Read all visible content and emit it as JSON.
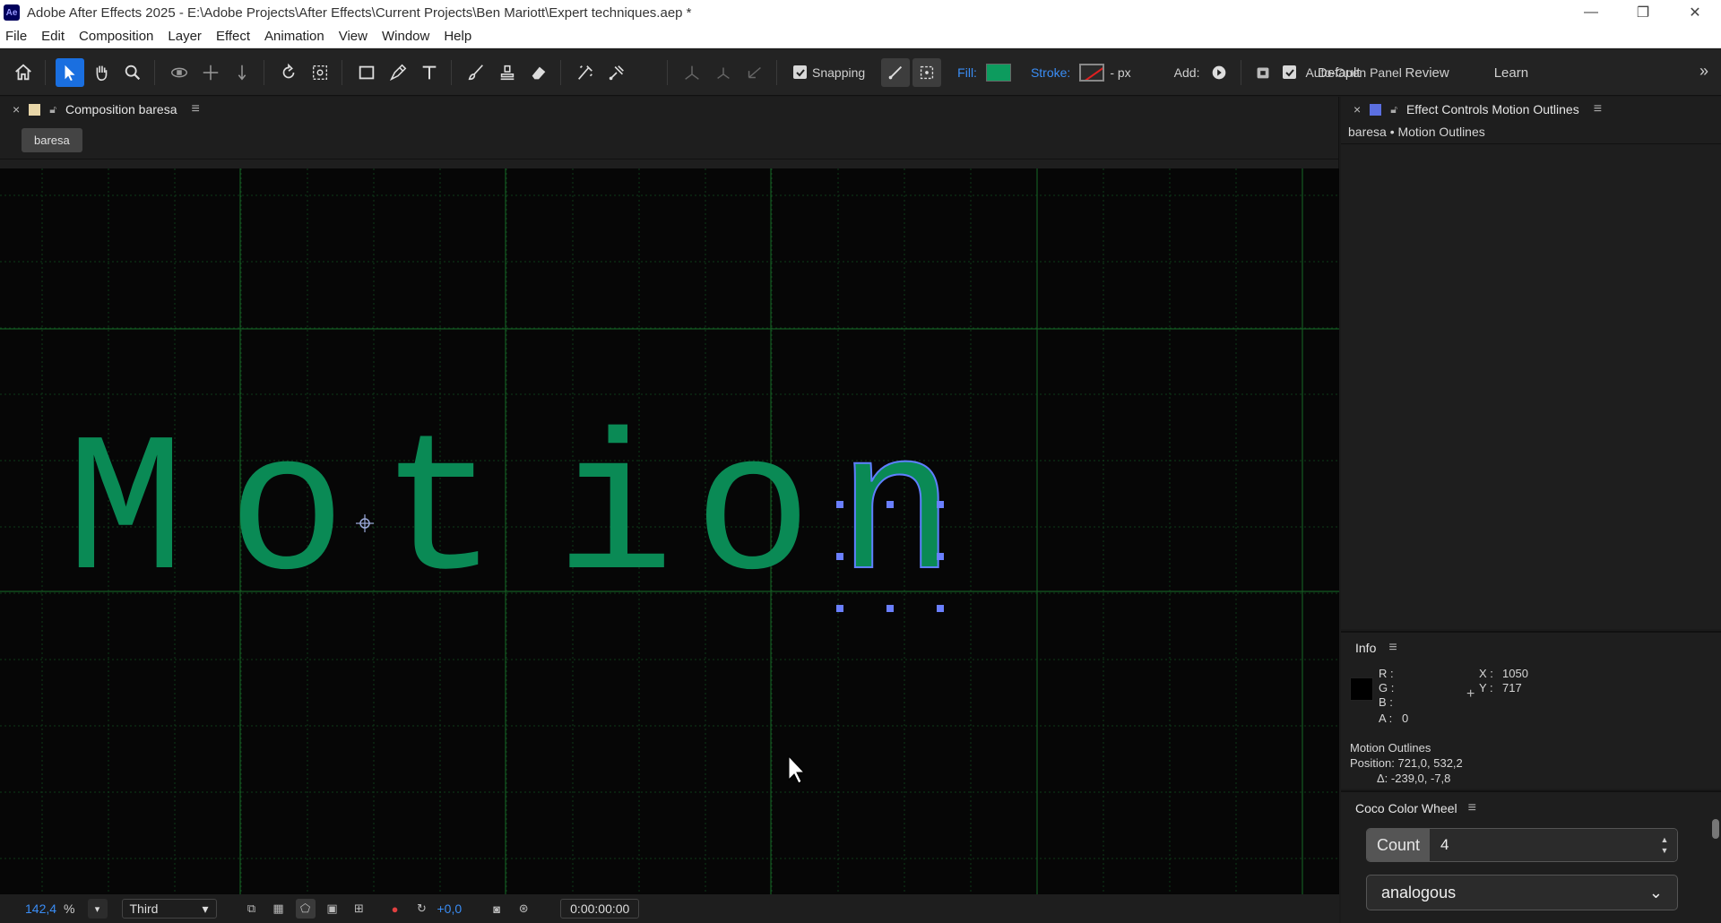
{
  "window": {
    "app_icon_text": "Ae",
    "title": "Adobe After Effects 2025 - E:\\Adobe Projects\\After Effects\\Current Projects\\Ben Mariott\\Expert techniques.aep *",
    "minimize": "—",
    "restore": "❐",
    "close": "✕"
  },
  "menu": [
    "File",
    "Edit",
    "Composition",
    "Layer",
    "Effect",
    "Animation",
    "View",
    "Window",
    "Help"
  ],
  "toolbar": {
    "snapping_label": "Snapping",
    "fill_label": "Fill:",
    "stroke_label": "Stroke:",
    "stroke_width": "- px",
    "add_label": "Add:",
    "auto_open_label": "Auto-Open Panel",
    "fill_color": "#0d9b5e",
    "workspaces": [
      "Default",
      "Review",
      "Learn"
    ],
    "more": "»"
  },
  "composition": {
    "tab_close": "×",
    "tab_title": "Composition baresa",
    "tab_menu": "≡",
    "crumb": "baresa",
    "text_letters": [
      "M",
      "o",
      "t",
      "i",
      "o",
      "n"
    ],
    "text_color": "#0a8a55",
    "grid_color": "#0e3a18",
    "zoom_value": "142,4",
    "zoom_unit": "%",
    "view_mode": "Third",
    "exposure": "+0,0",
    "timecode": "0:00:00:00"
  },
  "effect_controls": {
    "tab_close": "×",
    "tab_title": "Effect Controls Motion Outlines",
    "tab_menu": "≡",
    "subtitle": "baresa • Motion Outlines",
    "swatch_color": "#5b6fe0"
  },
  "info": {
    "title": "Info",
    "menu": "≡",
    "r_label": "R :",
    "g_label": "G :",
    "b_label": "B :",
    "a_label": "A :",
    "a_value": "0",
    "x_label": "X :",
    "x_value": "1050",
    "y_label": "Y :",
    "y_value": "717",
    "layer_name": "Motion Outlines",
    "position": "Position: 721,0, 532,2",
    "delta": "Δ: -239,0, -7,8"
  },
  "coco": {
    "title": "Coco Color Wheel",
    "menu": "≡",
    "count_label": "Count",
    "count_value": "4",
    "scheme": "analogous"
  }
}
